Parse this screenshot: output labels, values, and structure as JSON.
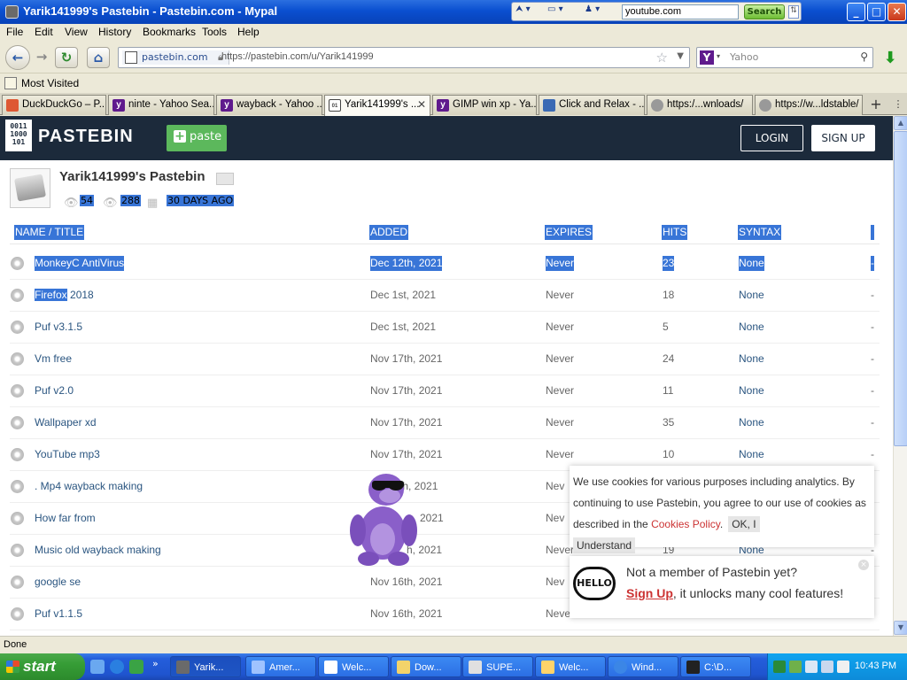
{
  "window": {
    "title": "Yarik141999's Pastebin - Pastebin.com - Mypal",
    "toolbar_search_value": "youtube.com",
    "toolbar_search_button": "Search",
    "minimize": "_",
    "maximize": "□",
    "close": "✕"
  },
  "menu": [
    "File",
    "Edit",
    "View",
    "History",
    "Bookmarks",
    "Tools",
    "Help"
  ],
  "nav": {
    "site_label": "pastebin.com",
    "url": "https://pastebin.com/u/Yarik141999",
    "search_placeholder": "Yahoo",
    "search_engine_icon": "Y"
  },
  "bookmarks": {
    "most_visited": "Most Visited"
  },
  "tabs": [
    {
      "label": "DuckDuckGo – P...",
      "icon_color": "#de5833"
    },
    {
      "label": "ninte - Yahoo Sea...",
      "icon_color": "#5f1a8d"
    },
    {
      "label": "wayback - Yahoo ...",
      "icon_color": "#5f1a8d"
    },
    {
      "label": "Yarik141999's ...",
      "icon_color": "#444444",
      "active": true
    },
    {
      "label": "GIMP win xp - Ya...",
      "icon_color": "#5f1a8d"
    },
    {
      "label": "Click and Relax - ...",
      "icon_color": "#3b6ab4"
    },
    {
      "label": "https:/...wnloads/",
      "icon_color": "#777777"
    },
    {
      "label": "https://w...ldstable/",
      "icon_color": "#777777"
    }
  ],
  "tab_new": "+",
  "tab_list": "⋮",
  "pastebin": {
    "logo_bits": "0011\n1000\n101",
    "logo_text": "PASTEBIN",
    "paste_button": "paste",
    "login": "LOGIN",
    "signup": "SIGN UP",
    "user_title": "Yarik141999's Pastebin",
    "stats": {
      "pastes": "54",
      "views": "288",
      "age": "30 DAYS AGO"
    },
    "columns": {
      "name": "NAME / TITLE",
      "added": "ADDED",
      "expires": "EXPIRES",
      "hits": "HITS",
      "syntax": "SYNTAX"
    },
    "rows": [
      {
        "title": "MonkeyC AntiVirus",
        "added": "Dec 12th, 2021",
        "expires": "Never",
        "hits": "23",
        "syntax": "None",
        "dash": "-"
      },
      {
        "title_sel": "Firefox",
        "title_rest": " 2018",
        "added": "Dec 1st, 2021",
        "expires": "Never",
        "hits": "18",
        "syntax": "None",
        "dash": "-"
      },
      {
        "title": "Puf v3.1.5",
        "added": "Dec 1st, 2021",
        "expires": "Never",
        "hits": "5",
        "syntax": "None",
        "dash": "-"
      },
      {
        "title": "Vm free",
        "added": "Nov 17th, 2021",
        "expires": "Never",
        "hits": "24",
        "syntax": "None",
        "dash": "-"
      },
      {
        "title": "Puf v2.0",
        "added": "Nov 17th, 2021",
        "expires": "Never",
        "hits": "11",
        "syntax": "None",
        "dash": "-"
      },
      {
        "title": "Wallpaper xd",
        "added": "Nov 17th, 2021",
        "expires": "Never",
        "hits": "35",
        "syntax": "None",
        "dash": "-"
      },
      {
        "title": "YouTube mp3",
        "added": "Nov 17th, 2021",
        "expires": "Never",
        "hits": "10",
        "syntax": "None",
        "dash": "-"
      },
      {
        "title": ". Mp4 wayback making",
        "added": "th, 2021",
        "expires": "Nev",
        "hits": "",
        "syntax": "",
        "dash": ""
      },
      {
        "title": "How far from",
        "added": "2021",
        "expires": "Nev",
        "hits": "",
        "syntax": "",
        "dash": ""
      },
      {
        "title": "Music old wayback making",
        "added": "h, 2021",
        "expires": "Never",
        "hits": "19",
        "syntax": "None",
        "dash": "-"
      },
      {
        "title": "google se",
        "added": "Nov 16th, 2021",
        "expires": "Nev",
        "hits": "",
        "syntax": "",
        "dash": ""
      },
      {
        "title": "Puf v1.1.5",
        "added": "Nov 16th, 2021",
        "expires": "Neve",
        "hits": "",
        "syntax": "",
        "dash": ""
      }
    ],
    "cookie": {
      "text_before": "We use cookies for various purposes including analytics. By continuing to use Pastebin, you agree to our use of cookies as described in the ",
      "link": "Cookies Policy",
      "text_after": ".",
      "ok": "OK, I",
      "understand": "Understand"
    },
    "signup_notice": {
      "hello": "HELLO",
      "line1": "Not a member of Pastebin yet?",
      "link": "Sign Up",
      "line2_rest": ", it unlocks many cool features!",
      "close": "×"
    }
  },
  "status": "Done",
  "taskbar": {
    "start": "start",
    "tasks": [
      {
        "label": "Yarik...",
        "active": true,
        "icon_color": "#6a6a6a"
      },
      {
        "label": "Amer...",
        "active": false,
        "icon_color": "#9fc3ff"
      },
      {
        "label": "Welc...",
        "active": false,
        "icon_color": "#ffffff"
      },
      {
        "label": "Dow...",
        "active": false,
        "icon_color": "#f3d36a"
      },
      {
        "label": "SUPE...",
        "active": false,
        "icon_color": "#e0e0e0"
      },
      {
        "label": "Welc...",
        "active": false,
        "icon_color": "#ffd36a"
      },
      {
        "label": "Wind...",
        "active": false,
        "icon_color": "#3b86e6"
      },
      {
        "label": "C:\\D...",
        "active": false,
        "icon_color": "#222222"
      }
    ],
    "clock": "10:43 PM"
  }
}
